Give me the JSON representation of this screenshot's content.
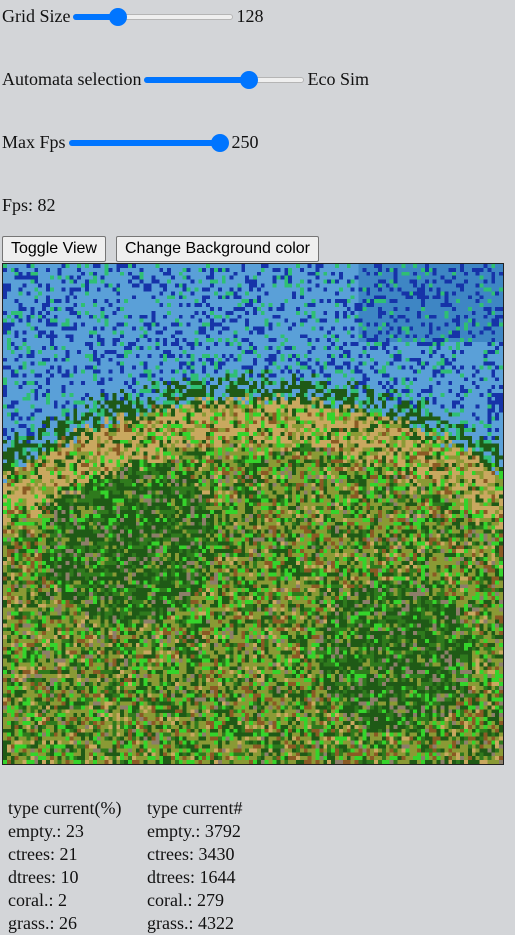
{
  "controls": {
    "grid_size": {
      "label": "Grid Size",
      "value": "128",
      "fraction": 0.25
    },
    "automata": {
      "label": "Automata selection",
      "value": "Eco Sim",
      "fraction": 0.67
    },
    "max_fps": {
      "label": "Max Fps",
      "value": "250",
      "fraction": 1.0
    }
  },
  "fps": {
    "label": "Fps:",
    "value": "82"
  },
  "buttons": {
    "toggle_view": "Toggle View",
    "change_bg": "Change Background color"
  },
  "colors": {
    "slider_accent": "#0075ff",
    "page_bg": "#d3d5d8",
    "water_light": "#5aa0d8",
    "water_mid": "#3e86c4",
    "water_deep": "#1633a8",
    "coral": "#2fbf73",
    "sand": "#c9a85f",
    "grass": "#8a9a35",
    "ctrees": "#1f5a16",
    "dtrees": "#2f7a1d",
    "bright_green": "#34d42b",
    "dirt": "#8a5a24",
    "rock": "#8c7e6a"
  },
  "stats": {
    "percent": {
      "header": "type current(%)",
      "rows": [
        "empty.: 23",
        "ctrees: 21",
        "dtrees: 10",
        "coral.: 2",
        "grass.: 26"
      ]
    },
    "count": {
      "header": "type current#",
      "rows": [
        "empty.: 3792",
        "ctrees: 3430",
        "dtrees: 1644",
        "coral.: 279",
        "grass.: 4322"
      ]
    }
  }
}
